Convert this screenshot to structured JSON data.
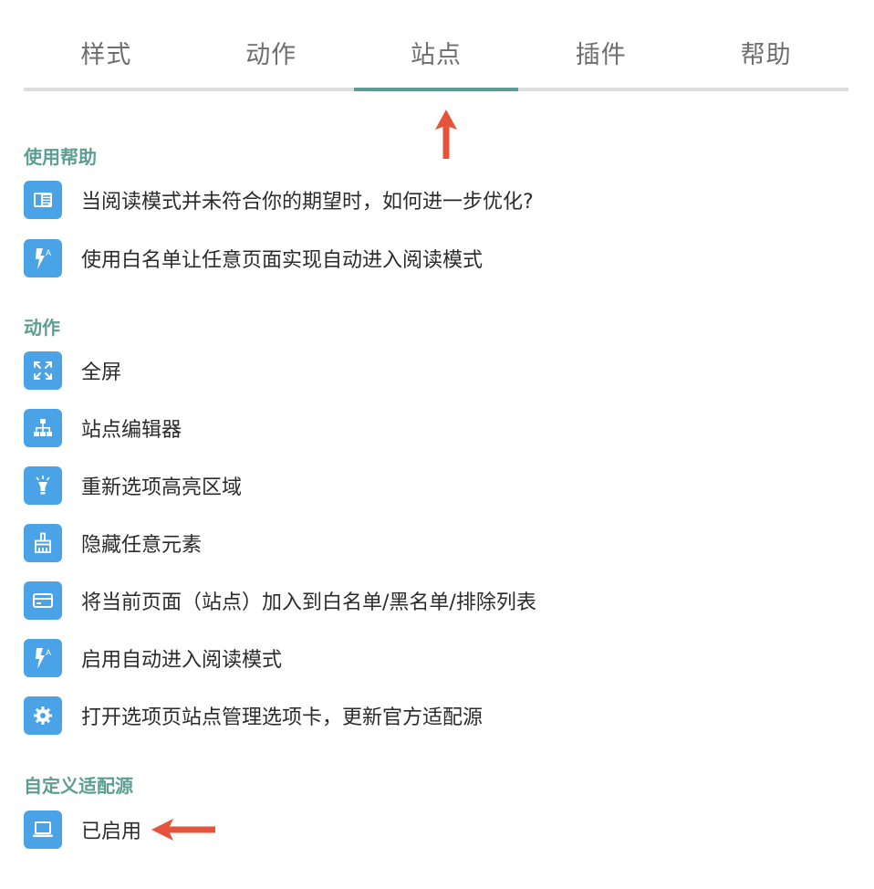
{
  "tabs": [
    {
      "label": "样式",
      "active": false
    },
    {
      "label": "动作",
      "active": false
    },
    {
      "label": "站点",
      "active": true
    },
    {
      "label": "插件",
      "active": false
    },
    {
      "label": "帮助",
      "active": false
    }
  ],
  "sections": {
    "help": {
      "title": "使用帮助",
      "items": [
        {
          "label": "当阅读模式并未符合你的期望时，如何进一步优化?",
          "icon": "reader-card-icon"
        },
        {
          "label": "使用白名单让任意页面实现自动进入阅读模式",
          "icon": "auto-flash-icon"
        }
      ]
    },
    "actions": {
      "title": "动作",
      "items": [
        {
          "label": "全屏",
          "icon": "fullscreen-icon"
        },
        {
          "label": "站点编辑器",
          "icon": "sitemap-icon"
        },
        {
          "label": "重新选项高亮区域",
          "icon": "lightbulb-icon"
        },
        {
          "label": "隐藏任意元素",
          "icon": "brush-icon"
        },
        {
          "label": "将当前页面（站点）加入到白名单/黑名单/排除列表",
          "icon": "card-icon"
        },
        {
          "label": "启用自动进入阅读模式",
          "icon": "auto-flash-icon"
        },
        {
          "label": "打开选项页站点管理选项卡，更新官方适配源",
          "icon": "gear-icon"
        }
      ]
    },
    "custom": {
      "title": "自定义适配源",
      "items": [
        {
          "label": "已启用",
          "icon": "laptop-icon"
        }
      ]
    }
  },
  "colors": {
    "accent": "#5b9d92",
    "icon_bg": "#4aa3e7",
    "annotation_arrow": "#e4533a"
  }
}
